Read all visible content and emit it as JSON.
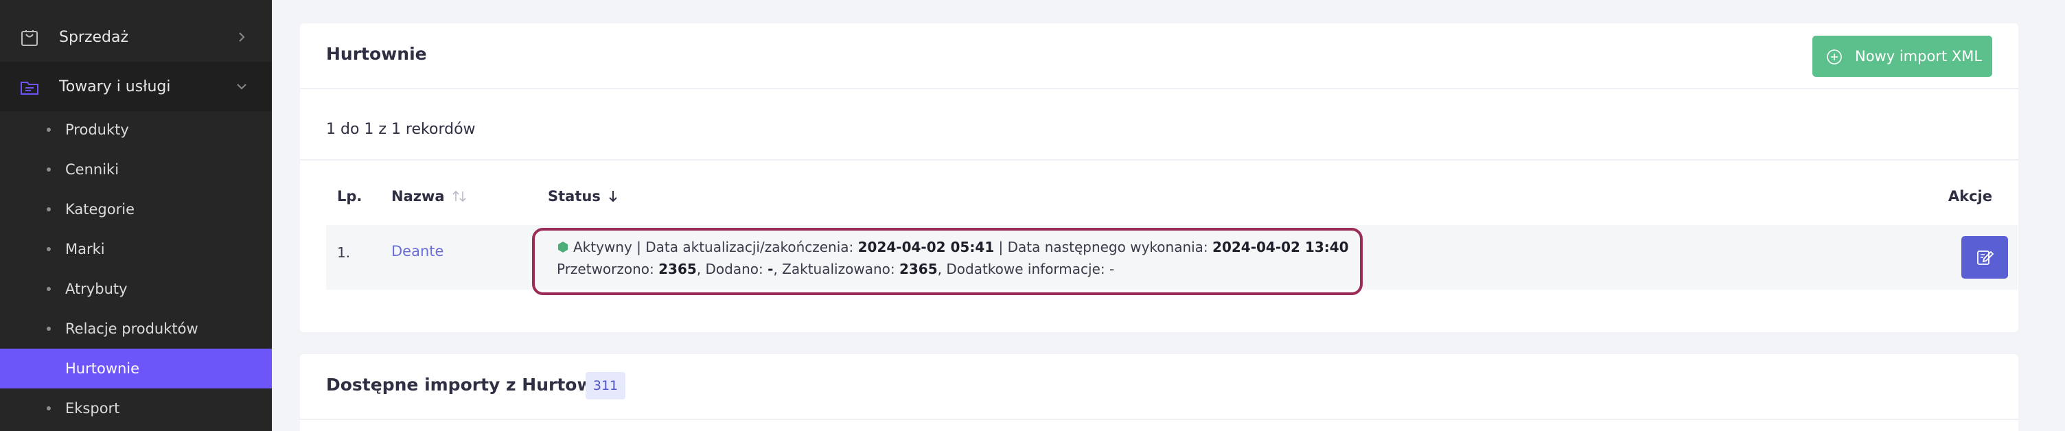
{
  "sidebar": {
    "sales": {
      "label": "Sprzedaż",
      "icon": "shopping-bag-icon"
    },
    "products": {
      "label": "Towary i usługi",
      "icon": "folder-icon"
    },
    "items": [
      {
        "label": "Produkty"
      },
      {
        "label": "Cenniki"
      },
      {
        "label": "Kategorie"
      },
      {
        "label": "Marki"
      },
      {
        "label": "Atrybuty"
      },
      {
        "label": "Relacje produktów"
      },
      {
        "label": "Hurtownie",
        "active": true
      },
      {
        "label": "Eksport"
      }
    ]
  },
  "wholesalers": {
    "title": "Hurtownie",
    "new_import_label": "Nowy import XML",
    "records_text": "1 do 1 z 1 rekordów",
    "columns": {
      "lp": "Lp.",
      "name": "Nazwa",
      "status": "Status",
      "actions": "Akcje"
    },
    "row": {
      "lp": "1.",
      "name": "Deante",
      "status": "Aktywny",
      "updated_label": "Data aktualizacji/zakończenia:",
      "updated": "2024-04-02 05:41",
      "next_label": "Data następnego wykonania:",
      "next": "2024-04-02 13:40",
      "processed_label": "Przetworzono:",
      "processed": "2365",
      "added_label": "Dodano:",
      "added": "-",
      "updated_count_label": "Zaktualizowano:",
      "updated_count": "2365",
      "extra_label": "Dodatkowe informacje:",
      "extra": "-"
    }
  },
  "available_imports": {
    "title": "Dostępne importy z Hurtowni",
    "count": "311"
  },
  "colors": {
    "sidebar_bg": "#262626",
    "active_item": "#6c55f9",
    "success_button": "#5cc08c",
    "link": "#6b6fd8",
    "status_active": "#4caf7a",
    "highlight_border": "#9b2c58",
    "edit_button": "#5a5fd4"
  }
}
